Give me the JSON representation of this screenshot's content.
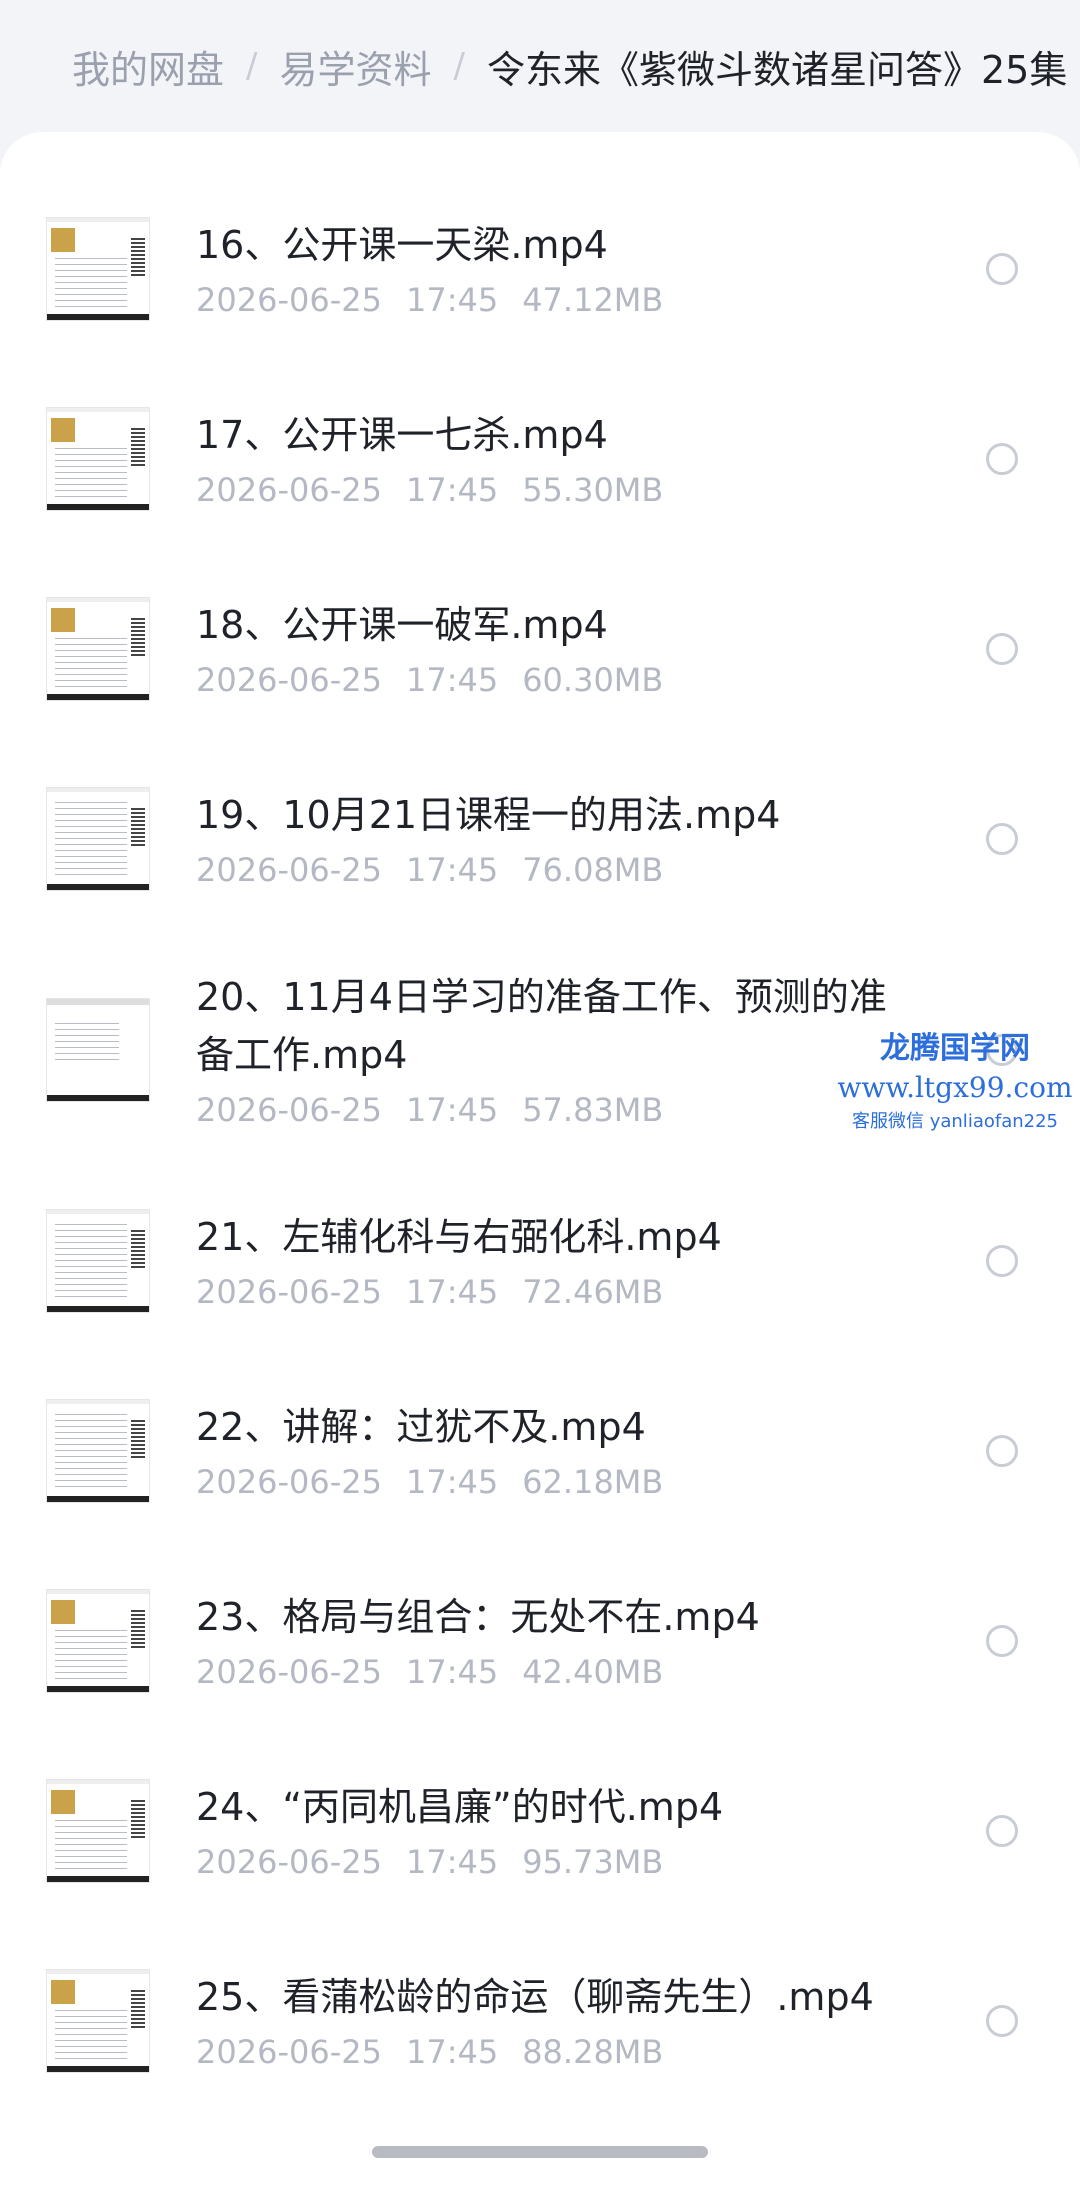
{
  "breadcrumb": {
    "items": [
      "我的网盘",
      "易学资料",
      "令东来《紫微斗数诸星问答》25集"
    ],
    "separator": "/"
  },
  "files": [
    {
      "name": "16、公开课一天梁.mp4",
      "date": "2026-06-25",
      "time": "17:45",
      "size": "47.12MB"
    },
    {
      "name": "17、公开课一七杀.mp4",
      "date": "2026-06-25",
      "time": "17:45",
      "size": "55.30MB"
    },
    {
      "name": "18、公开课一破军.mp4",
      "date": "2026-06-25",
      "time": "17:45",
      "size": "60.30MB"
    },
    {
      "name": "19、10月21日课程一的用法.mp4",
      "date": "2026-06-25",
      "time": "17:45",
      "size": "76.08MB"
    },
    {
      "name": "20、11月4日学习的准备工作、预测的准备工作.mp4",
      "date": "2026-06-25",
      "time": "17:45",
      "size": "57.83MB"
    },
    {
      "name": "21、左辅化科与右弼化科.mp4",
      "date": "2026-06-25",
      "time": "17:45",
      "size": "72.46MB"
    },
    {
      "name": "22、讲解：过犹不及.mp4",
      "date": "2026-06-25",
      "time": "17:45",
      "size": "62.18MB"
    },
    {
      "name": "23、格局与组合：无处不在.mp4",
      "date": "2026-06-25",
      "time": "17:45",
      "size": "42.40MB"
    },
    {
      "name": "24、“丙同机昌廉”的时代.mp4",
      "date": "2026-06-25",
      "time": "17:45",
      "size": "95.73MB"
    },
    {
      "name": "25、看蒲松龄的命运（聊斋先生）.mp4",
      "date": "2026-06-25",
      "time": "17:45",
      "size": "88.28MB"
    }
  ],
  "watermark": {
    "title": "龙腾国学网",
    "url": "www.ltgx99.com",
    "contact": "客服微信 yanliaofan225"
  },
  "colors": {
    "background": "#f3f4f8",
    "panel": "#ffffff",
    "text_primary": "#1f2329",
    "text_secondary": "#b3b8c2",
    "watermark": "#2c6edb"
  }
}
